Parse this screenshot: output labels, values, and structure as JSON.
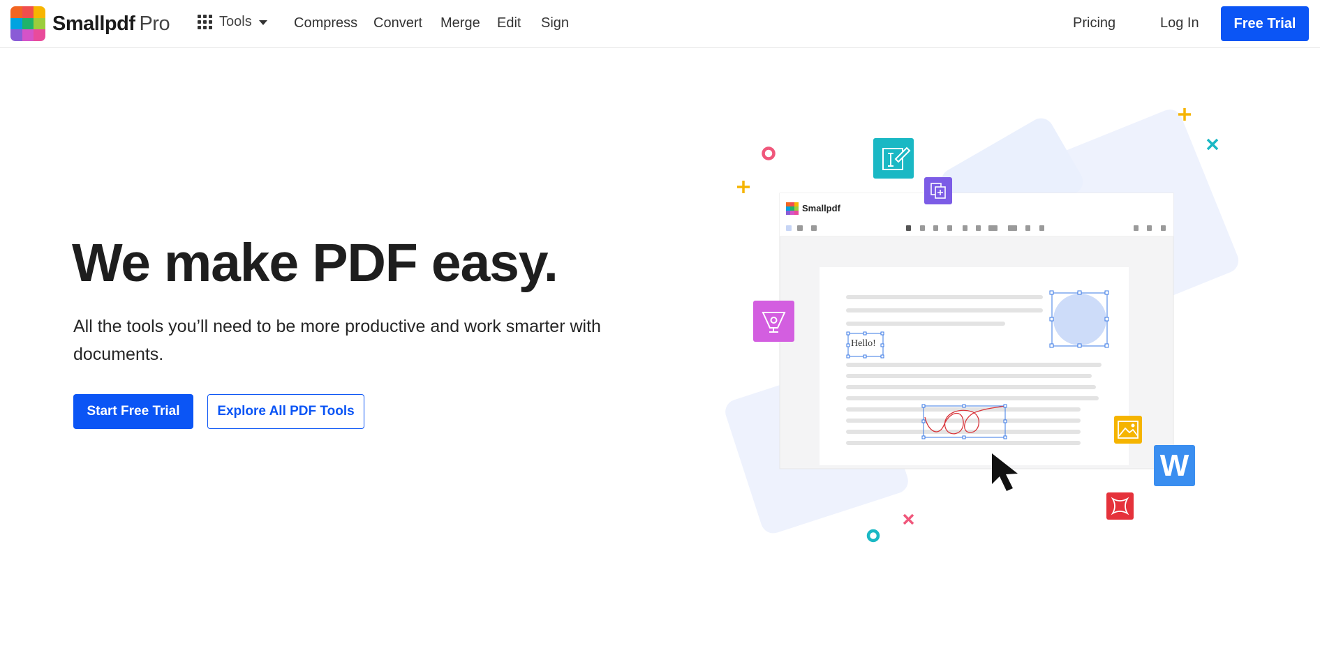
{
  "header": {
    "brand_name": "Smallpdf",
    "brand_tier": "Pro",
    "tools_label": "Tools",
    "nav": [
      "Compress",
      "Convert",
      "Merge",
      "Edit",
      "Sign"
    ],
    "pricing_label": "Pricing",
    "login_label": "Log In",
    "trial_label": "Free Trial"
  },
  "hero": {
    "title": "We make PDF easy.",
    "subtitle": "All the tools you’ll need to be more productive and work smarter with documents.",
    "primary_cta": "Start Free Trial",
    "secondary_cta": "Explore All PDF Tools"
  },
  "illustration": {
    "app_title": "Smallpdf",
    "text_box": "Hello!",
    "icons": [
      "edit-text-icon",
      "add-page-icon",
      "pen-nib-icon",
      "image-icon",
      "word-icon",
      "resize-icon",
      "plus-icon",
      "ring-icon",
      "x-icon"
    ],
    "word_letter": "W"
  },
  "colors": {
    "accent": "#0b55f5",
    "teal": "#1ab8c4",
    "purple": "#7c5ce6",
    "magenta": "#d35ee0",
    "yellow": "#f5b400",
    "blue": "#3a8ef0",
    "red": "#e5323b",
    "pink": "#f0577b"
  }
}
